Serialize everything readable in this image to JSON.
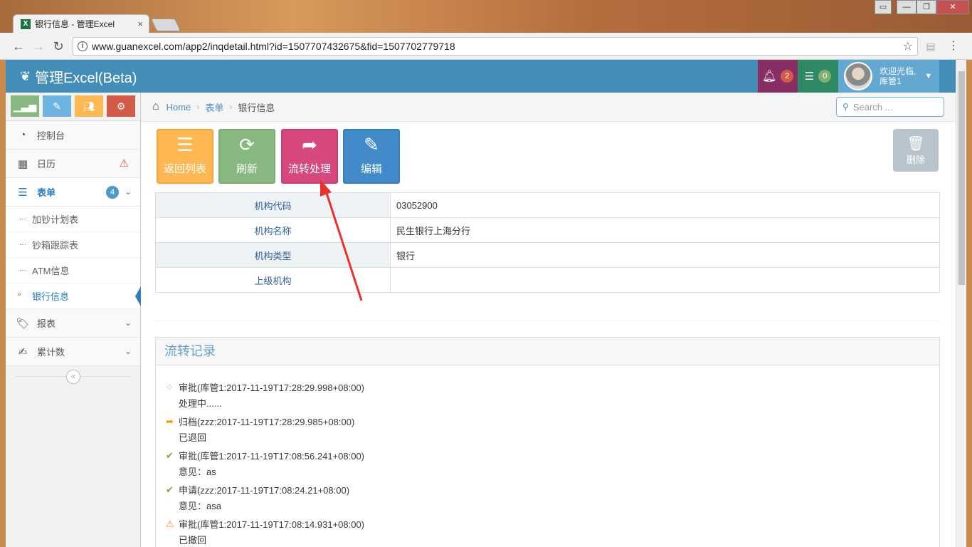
{
  "browser": {
    "tab_title": "银行信息 - 管理Excel",
    "tab_close": "×",
    "url": "www.guanexcel.com/app2/inqdetail.html?id=1507707432675&fid=1507702779718",
    "window_controls": [
      "▭",
      "—",
      "❐",
      "✕"
    ]
  },
  "navbar": {
    "brand": "管理Excel(Beta)",
    "notifications_count": "2",
    "tasks_count": "0",
    "welcome": "欢迎光临,",
    "username": "库管1",
    "colors": {
      "bg": "#438eb9",
      "bell_bg": "#892e65",
      "tasks_bg": "#2e8965"
    }
  },
  "sidebar": {
    "shortcuts": [
      {
        "icon": "signal-icon",
        "color": "#87b87f"
      },
      {
        "icon": "pencil-icon",
        "color": "#6fb3e0"
      },
      {
        "icon": "users-icon",
        "color": "#ffb752"
      },
      {
        "icon": "cogs-icon",
        "color": "#d15b47"
      }
    ],
    "items": [
      {
        "label": "控制台",
        "icon": "dashboard-icon"
      },
      {
        "label": "日历",
        "icon": "calendar-icon",
        "alert": "warning-icon"
      },
      {
        "label": "表单",
        "icon": "list-icon",
        "badge": "4"
      }
    ],
    "subitems": [
      "加钞计划表",
      "钞箱跟踪表",
      "ATM信息",
      "银行信息"
    ],
    "after_items": [
      {
        "label": "报表",
        "icon": "tag-icon"
      },
      {
        "label": "累计数",
        "icon": "edit-icon"
      }
    ]
  },
  "breadcrumb": {
    "home": "Home",
    "form": "表单",
    "current": "银行信息"
  },
  "search": {
    "placeholder": "Search ..."
  },
  "actions": {
    "back": "返回列表",
    "refresh": "刷新",
    "flow": "流转处理",
    "edit": "编辑",
    "delete": "删除",
    "colors": {
      "back": "#ffb752",
      "refresh": "#87b87f",
      "flow": "#d6487e",
      "edit": "#428bca"
    }
  },
  "details": [
    {
      "label": "机构代码",
      "value": "03052900"
    },
    {
      "label": "机构名称",
      "value": "民生银行上海分行"
    },
    {
      "label": "机构类型",
      "value": "银行"
    },
    {
      "label": "上级机构",
      "value": ""
    }
  ],
  "flow": {
    "title": "流转记录",
    "records": [
      {
        "icon": "spinner-icon",
        "head": "审批(库管1:2017-11-19T17:28:29.998+08:00)",
        "note": "处理中......"
      },
      {
        "icon": "share-icon",
        "head": "归档(zzz:2017-11-19T17:28:29.985+08:00)",
        "note": "已退回"
      },
      {
        "icon": "check-icon",
        "head": "审批(库管1:2017-11-19T17:08:56.241+08:00)",
        "note": "意见：as"
      },
      {
        "icon": "check-icon",
        "head": "申请(zzz:2017-11-19T17:08:24.21+08:00)",
        "note": "意见：asa"
      },
      {
        "icon": "warning-icon",
        "head": "审批(库管1:2017-11-19T17:08:14.931+08:00)",
        "note": "已撤回"
      }
    ]
  }
}
